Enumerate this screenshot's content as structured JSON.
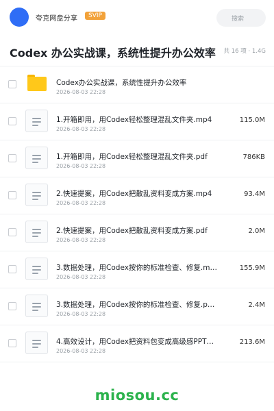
{
  "header": {
    "app_name": "夸克网盘分享",
    "badge": "SVIP",
    "search_placeholder": "搜索"
  },
  "folder": {
    "title": "Codex 办公实战课，系统性提升办公效率",
    "meta": "共 16 项 · 1.4G"
  },
  "files": [
    {
      "type": "folder",
      "name": "Codex办公实战课，系统性提升办公效率",
      "date": "2026-08-03 22:28",
      "size": ""
    },
    {
      "type": "doc",
      "name": "1.开箱即用，用Codex轻松整理混乱文件夹.mp4",
      "date": "2026-08-03 22:28",
      "size": "115.0M"
    },
    {
      "type": "doc",
      "name": "1.开箱即用，用Codex轻松整理混乱文件夹.pdf",
      "date": "2026-08-03 22:28",
      "size": "786KB"
    },
    {
      "type": "doc",
      "name": "2.快速提案，用Codex把散乱资料变成方案.mp4",
      "date": "2026-08-03 22:28",
      "size": "93.4M"
    },
    {
      "type": "doc",
      "name": "2.快速提案，用Codex把散乱资料变成方案.pdf",
      "date": "2026-08-03 22:28",
      "size": "2.0M"
    },
    {
      "type": "doc",
      "name": "3.数据处理，用Codex按你的标准检查、修复.m…",
      "date": "2026-08-03 22:28",
      "size": "155.9M"
    },
    {
      "type": "doc",
      "name": "3.数据处理，用Codex按你的标准检查、修复.p…",
      "date": "2026-08-03 22:28",
      "size": "2.4M"
    },
    {
      "type": "doc",
      "name": "4.高效设计，用Codex把资料包变成高级感PPT…",
      "date": "2026-08-03 22:28",
      "size": "213.6M"
    }
  ],
  "watermark": "miosou.cc",
  "colors": {
    "accent": "#2f6df6",
    "badge": "#f2a23a",
    "folder": "#ffc81a",
    "watermark": "#2bb24c"
  },
  "icons": {
    "folder": "folder-icon",
    "doc": "document-icon",
    "avatar": "avatar"
  }
}
